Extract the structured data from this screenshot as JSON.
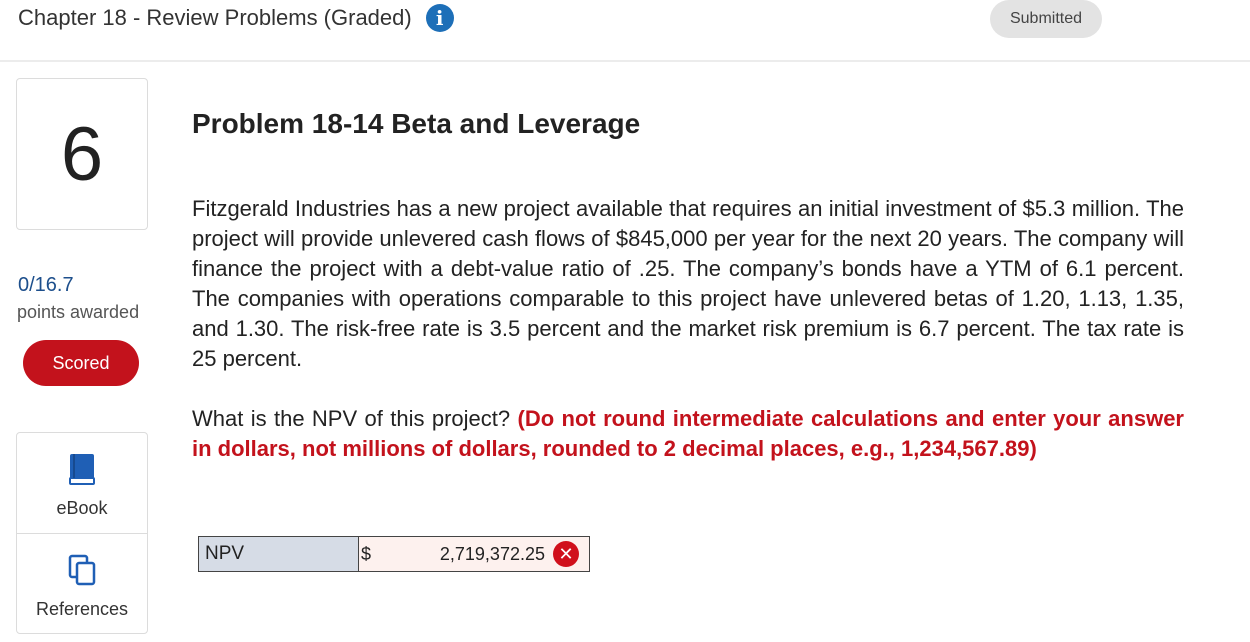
{
  "header": {
    "chapter_title": "Chapter 18 - Review Problems (Graded)",
    "status_badge": "Submitted"
  },
  "sidebar": {
    "question_number": "6",
    "score": "0/16.7",
    "score_label": "points awarded",
    "scored_button": "Scored",
    "tools": [
      {
        "label": "eBook",
        "icon": "book-icon"
      },
      {
        "label": "References",
        "icon": "documents-icon"
      }
    ]
  },
  "problem": {
    "title": "Problem 18-14 Beta and Leverage",
    "body": "Fitzgerald Industries has a new project available that requires an initial investment of $5.3 million. The project will provide unlevered cash flows of $845,000 per year for the next 20 years. The company will finance the project with a debt-value ratio of .25. The company’s bonds have a YTM of 6.1 percent. The companies with operations comparable to this project have unlevered betas of 1.20, 1.13, 1.35, and 1.30. The risk-free rate is 3.5 percent and the market risk premium is 6.7 percent. The tax rate is 25 percent.",
    "question": "What is the NPV of this project?",
    "instructions": "(Do not round intermediate calculations and enter your answer in dollars, not millions of dollars, rounded to 2 decimal places, e.g., 1,234,567.89)"
  },
  "answer": {
    "label": "NPV",
    "currency": "$",
    "value": "2,719,372.25",
    "status_icon": "incorrect-x-icon"
  },
  "colors": {
    "accent_red": "#c3121c",
    "info_blue": "#1d6fb8",
    "label_bg": "#d6dce6",
    "input_bg": "#fdf1ee"
  }
}
